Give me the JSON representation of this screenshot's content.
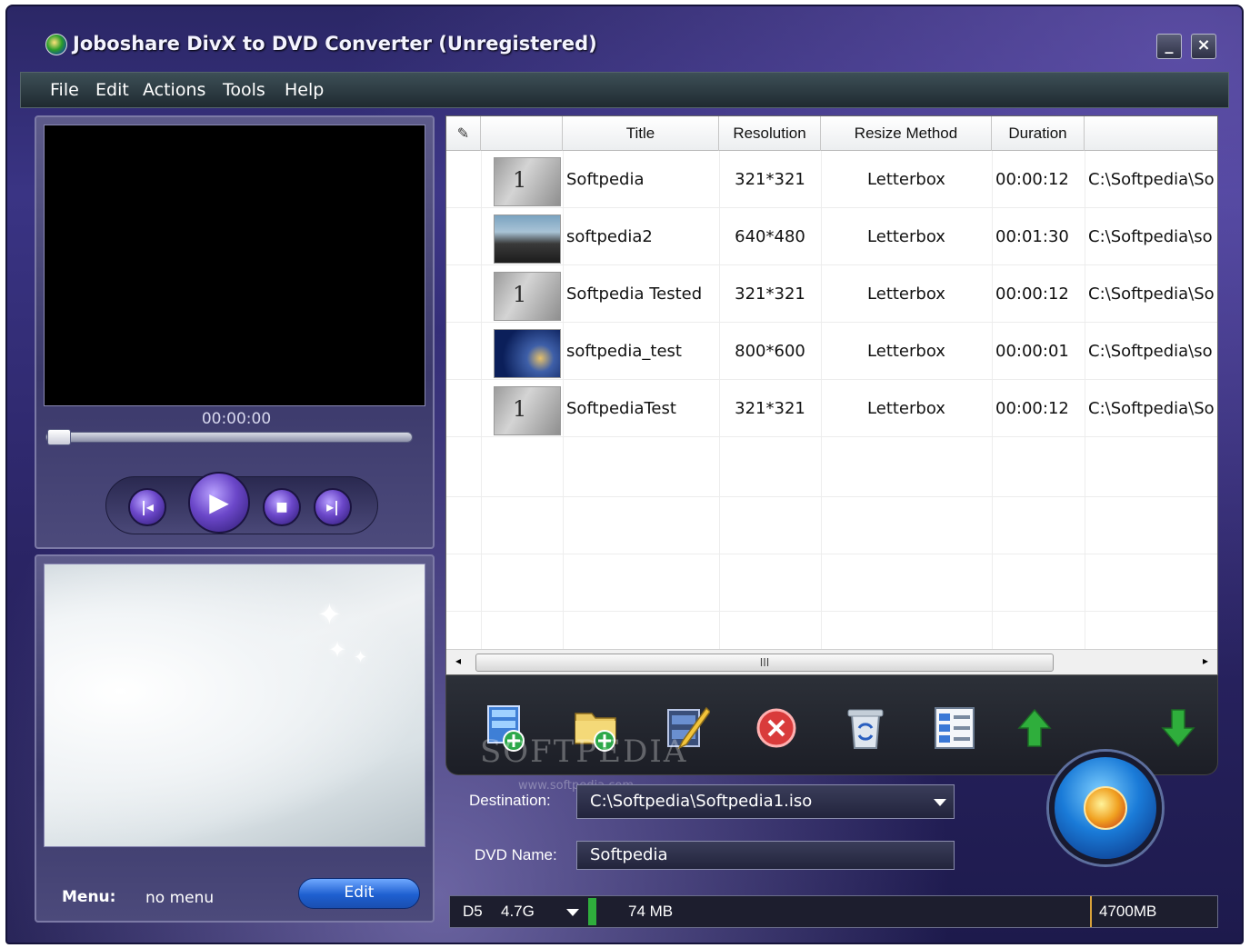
{
  "window": {
    "title": "Joboshare DivX to DVD Converter (Unregistered)",
    "minimize_label": "_",
    "close_label": "×"
  },
  "menubar": [
    "File",
    "Edit",
    "Actions",
    "Tools",
    "Help"
  ],
  "player": {
    "time": "00:00:00",
    "progress": 0,
    "controls": [
      "previous-icon",
      "play-icon",
      "stop-icon",
      "next-icon"
    ]
  },
  "menu_panel": {
    "label": "Menu:",
    "value": "no menu",
    "edit_label": "Edit"
  },
  "table": {
    "columns": [
      "",
      "",
      "Title",
      "Resolution",
      "Resize Method",
      "Duration",
      ""
    ],
    "rows": [
      {
        "title": "Softpedia",
        "resolution": "321*321",
        "resize": "Letterbox",
        "duration": "00:00:12",
        "path": "C:\\Softpedia\\So",
        "thumb": "gray",
        "thumb_text": "1"
      },
      {
        "title": "softpedia2",
        "resolution": "640*480",
        "resize": "Letterbox",
        "duration": "00:01:30",
        "path": "C:\\Softpedia\\so",
        "thumb": "people",
        "thumb_text": ""
      },
      {
        "title": "Softpedia Tested",
        "resolution": "321*321",
        "resize": "Letterbox",
        "duration": "00:00:12",
        "path": "C:\\Softpedia\\So",
        "thumb": "gray",
        "thumb_text": "1"
      },
      {
        "title": "softpedia_test",
        "resolution": "800*600",
        "resize": "Letterbox",
        "duration": "00:00:01",
        "path": "C:\\Softpedia\\so",
        "thumb": "blue",
        "thumb_text": ""
      },
      {
        "title": "SoftpediaTest",
        "resolution": "321*321",
        "resize": "Letterbox",
        "duration": "00:00:12",
        "path": "C:\\Softpedia\\So",
        "thumb": "gray",
        "thumb_text": "1"
      }
    ],
    "scroll_thumb_label": "III"
  },
  "toolbar": {
    "icons": [
      "add-video-icon",
      "add-folder-icon",
      "edit-video-icon",
      "remove-icon",
      "recycle-bin-icon",
      "properties-icon",
      "move-up-icon",
      "move-down-icon"
    ]
  },
  "watermark": {
    "text": "SOFTPEDIA",
    "url": "www.softpedia.com"
  },
  "destination": {
    "label": "Destination:",
    "value": "C:\\Softpedia\\Softpedia1.iso"
  },
  "dvd_name": {
    "label": "DVD Name:",
    "value": "Softpedia"
  },
  "status": {
    "disc_type": "D5",
    "disc_size": "4.7G",
    "used": "74 MB",
    "capacity": "4700MB",
    "used_fraction": 0.016
  },
  "colors": {
    "accent": "#3a3484",
    "play_button": "#6b47c9",
    "edit_button": "#1e5fd0",
    "used_bar": "#2fae3c"
  }
}
